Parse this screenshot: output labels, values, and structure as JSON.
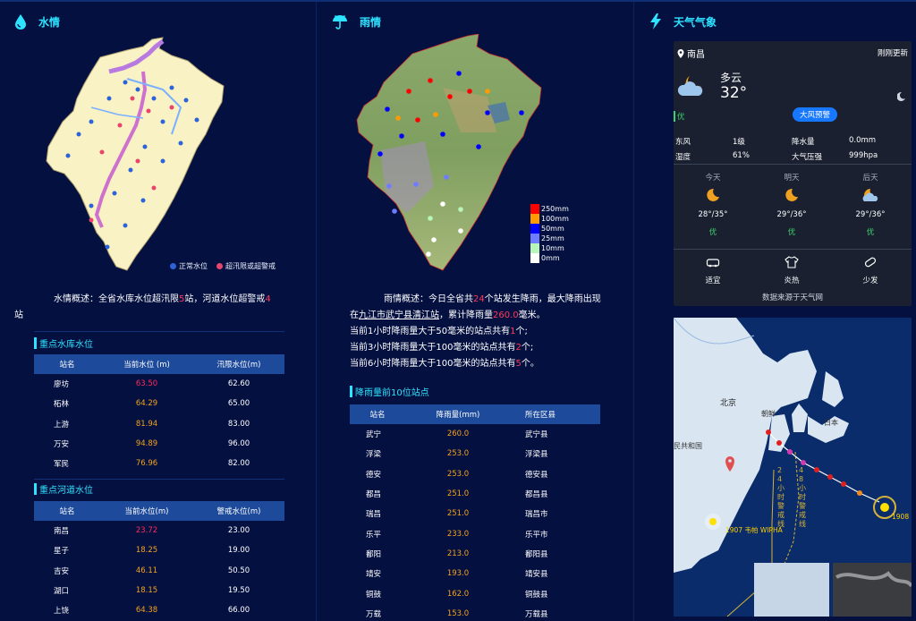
{
  "water": {
    "title": "水情",
    "legend_normal": "正常水位",
    "legend_over": "超汛限或超警戒",
    "summary_prefix": "水情概述：全省水库水位超汛限",
    "summary_reservoir_count": "5",
    "summary_mid": "站，河道水位超警戒",
    "summary_river_count": "4",
    "summary_suffix": "站",
    "reservoir_title": "重点水库水位",
    "reservoir_headers": [
      "站名",
      "当前水位 (m)",
      "汛限水位(m)"
    ],
    "reservoir_rows": [
      {
        "name": "廖坊",
        "level": "63.50",
        "limit": "62.60",
        "level_color": "#ff2d5a"
      },
      {
        "name": "柘林",
        "level": "64.29",
        "limit": "65.00",
        "level_color": "#f4a41c"
      },
      {
        "name": "上游",
        "level": "81.94",
        "limit": "83.00",
        "level_color": "#f4a41c"
      },
      {
        "name": "万安",
        "level": "94.89",
        "limit": "96.00",
        "level_color": "#f4a41c"
      },
      {
        "name": "军民",
        "level": "76.96",
        "limit": "82.00",
        "level_color": "#f4a41c"
      }
    ],
    "river_title": "重点河道水位",
    "river_headers": [
      "站名",
      "当前水位(m)",
      "警戒水位(m)"
    ],
    "river_rows": [
      {
        "name": "南昌",
        "level": "23.72",
        "limit": "23.00",
        "level_color": "#ff2d5a"
      },
      {
        "name": "星子",
        "level": "18.25",
        "limit": "19.00",
        "level_color": "#f4a41c"
      },
      {
        "name": "吉安",
        "level": "46.11",
        "limit": "50.50",
        "level_color": "#f4a41c"
      },
      {
        "name": "湖口",
        "level": "18.15",
        "limit": "19.50",
        "level_color": "#f4a41c"
      },
      {
        "name": "上饶",
        "level": "64.38",
        "limit": "66.00",
        "level_color": "#f4a41c"
      }
    ]
  },
  "rain": {
    "title": "雨情",
    "legend": [
      "250mm",
      "100mm",
      "50mm",
      "25mm",
      "10mm",
      "0mm"
    ],
    "legend_colors": [
      "#ff0000",
      "#ff9a00",
      "#0000ff",
      "#6e7cff",
      "#b8f5b8",
      "#ffffff"
    ],
    "summary_l1_a": "雨情概述：今日全省共",
    "summary_count": "24",
    "summary_l1_b": "个站发生降雨，最大降雨出现",
    "summary_l2_a": "在",
    "summary_station": "九江市武宁县清江站",
    "summary_l2_b": "，累计降雨量",
    "summary_total": "260.0",
    "summary_l2_c": "毫米。",
    "l3_a": "当前1小时降雨量大于50毫米的站点共有",
    "l3_n": "1",
    "l3_b": "个;",
    "l4_a": "当前3小时降雨量大于100毫米的站点共有",
    "l4_n": "2",
    "l4_b": "个;",
    "l5_a": "当前6小时降雨量大于100毫米的站点共有",
    "l5_n": "5",
    "l5_b": "个。",
    "top_title": "降雨量前10位站点",
    "top_headers": [
      "站名",
      "降雨量(mm)",
      "所在区县"
    ],
    "top_rows": [
      {
        "name": "武宁",
        "value": "260.0",
        "county": "武宁县"
      },
      {
        "name": "浮梁",
        "value": "253.0",
        "county": "浮梁县"
      },
      {
        "name": "德安",
        "value": "253.0",
        "county": "德安县"
      },
      {
        "name": "都昌",
        "value": "251.0",
        "county": "都昌县"
      },
      {
        "name": "瑞昌",
        "value": "251.0",
        "county": "瑞昌市"
      },
      {
        "name": "乐平",
        "value": "233.0",
        "county": "乐平市"
      },
      {
        "name": "鄱阳",
        "value": "213.0",
        "county": "鄱阳县"
      },
      {
        "name": "靖安",
        "value": "193.0",
        "county": "靖安县"
      },
      {
        "name": "铜鼓",
        "value": "162.0",
        "county": "铜鼓县"
      },
      {
        "name": "万载",
        "value": "153.0",
        "county": "万载县"
      }
    ]
  },
  "weather": {
    "title": "天气气象",
    "city": "南昌",
    "update": "刚刚更新",
    "condition": "多云",
    "temp": "32°",
    "aqi": "优",
    "alert": "大风预警",
    "wind_label": "东风",
    "wind_value": "1级",
    "rain_label": "降水量",
    "rain_value": "0.0mm",
    "hum_label": "湿度",
    "hum_value": "61%",
    "pressure_label": "大气压强",
    "pressure_value": "999hpa",
    "forecast": [
      {
        "day": "今天",
        "range": "28°/35°",
        "aqi": "优"
      },
      {
        "day": "明天",
        "range": "29°/36°",
        "aqi": "优"
      },
      {
        "day": "后天",
        "range": "29°/36°",
        "aqi": "优"
      }
    ],
    "life": [
      "适宜",
      "炎热",
      "少发"
    ],
    "source": "数据来源于天气网",
    "map_beijing": "北京",
    "map_korea": "朝鲜",
    "map_japan": "日本",
    "map_prc": "民共和国",
    "map_24h": "24小时警戒线",
    "map_48h": "48小时警戒线",
    "typhoon1": "1907 韦帕 WIPHA",
    "typhoon2": "1908"
  }
}
